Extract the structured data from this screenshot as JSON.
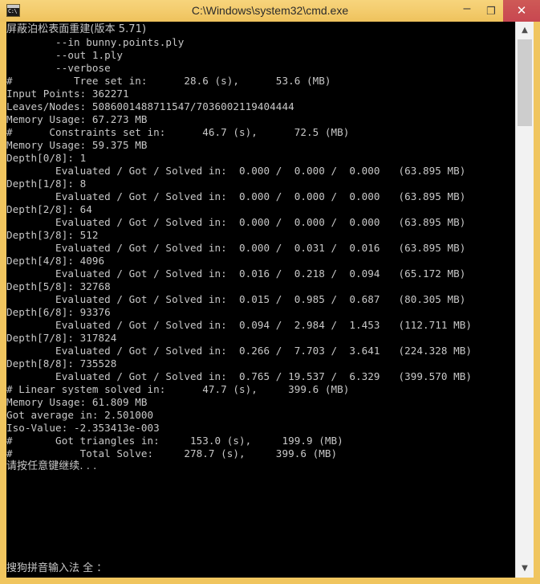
{
  "window": {
    "title": "C:\\Windows\\system32\\cmd.exe",
    "icon": "console-icon",
    "icon_text": "C:\\",
    "frame_color": "#f0c55f",
    "titlebar_color": "#f3cb6c",
    "close_button_color": "#c84751"
  },
  "titlebar_buttons": {
    "minimize": "–",
    "maximize": "❐",
    "close": "✕"
  },
  "console": {
    "background_color": "#000000",
    "text_color": "#c8c8c8",
    "lines": [
      "屏蔽泊松表面重建(版本 5.71)",
      "        --in bunny.points.ply",
      "        --out 1.ply",
      "        --verbose",
      "#          Tree set in:      28.6 (s),      53.6 (MB)",
      "Input Points: 362271",
      "Leaves/Nodes: 5086001488711547/7036002119404444",
      "Memory Usage: 67.273 MB",
      "#      Constraints set in:      46.7 (s),      72.5 (MB)",
      "Memory Usage: 59.375 MB",
      "Depth[0/8]: 1",
      "        Evaluated / Got / Solved in:  0.000 /  0.000 /  0.000   (63.895 MB)",
      "Depth[1/8]: 8",
      "        Evaluated / Got / Solved in:  0.000 /  0.000 /  0.000   (63.895 MB)",
      "Depth[2/8]: 64",
      "        Evaluated / Got / Solved in:  0.000 /  0.000 /  0.000   (63.895 MB)",
      "Depth[3/8]: 512",
      "        Evaluated / Got / Solved in:  0.000 /  0.031 /  0.016   (63.895 MB)",
      "Depth[4/8]: 4096",
      "        Evaluated / Got / Solved in:  0.016 /  0.218 /  0.094   (65.172 MB)",
      "Depth[5/8]: 32768",
      "        Evaluated / Got / Solved in:  0.015 /  0.985 /  0.687   (80.305 MB)",
      "Depth[6/8]: 93376",
      "        Evaluated / Got / Solved in:  0.094 /  2.984 /  1.453   (112.711 MB)",
      "Depth[7/8]: 317824",
      "        Evaluated / Got / Solved in:  0.266 /  7.703 /  3.641   (224.328 MB)",
      "Depth[8/8]: 735528",
      "        Evaluated / Got / Solved in:  0.765 / 19.537 /  6.329   (399.570 MB)",
      "# Linear system solved in:      47.7 (s),     399.6 (MB)",
      "Memory Usage: 61.809 MB",
      "Got average in: 2.501000",
      "Iso-Value: -2.353413e-003",
      "#       Got triangles in:     153.0 (s),     199.9 (MB)",
      "#           Total Solve:     278.7 (s),     399.6 (MB)",
      "请按任意键继续. . ."
    ],
    "ime_status": "搜狗拼音输入法 全 ："
  },
  "scrollbar": {
    "up_arrow": "▲",
    "down_arrow": "▼",
    "thumb_color": "#cdcdcd",
    "track_color": "#f2f2f2"
  }
}
